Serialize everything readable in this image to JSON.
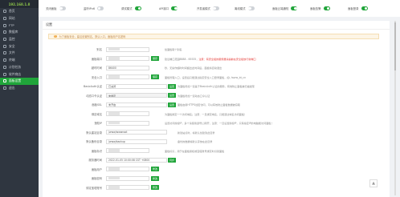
{
  "app": {
    "logo": "192.168.1.8"
  },
  "sidebar": {
    "items": [
      {
        "label": "首页",
        "icon": "home-icon",
        "color": "#9aa3ad"
      },
      {
        "label": "网站",
        "icon": "globe-icon",
        "color": "#9aa3ad"
      },
      {
        "label": "FTP",
        "icon": "ftp-icon",
        "color": "#9aa3ad"
      },
      {
        "label": "数据库",
        "icon": "database-icon",
        "color": "#9aa3ad"
      },
      {
        "label": "监控",
        "icon": "monitor-icon",
        "color": "#9aa3ad"
      },
      {
        "label": "安全",
        "icon": "shield-icon",
        "color": "#9aa3ad"
      },
      {
        "label": "文件",
        "icon": "folder-icon",
        "color": "#9aa3ad"
      },
      {
        "label": "终端",
        "icon": "terminal-icon",
        "color": "#9aa3ad"
      },
      {
        "label": "计划任务",
        "icon": "clock-icon",
        "color": "#9aa3ad"
      },
      {
        "label": "软件商店",
        "icon": "store-icon",
        "color": "#9aa3ad"
      },
      {
        "label": "面板设置",
        "icon": "gear-icon",
        "color": "#ffffff",
        "active": true
      },
      {
        "label": "退出",
        "icon": "logout-icon",
        "color": "#9aa3ad"
      }
    ]
  },
  "topbar": {
    "toggles": [
      {
        "label": "关闭面板",
        "on": false
      },
      {
        "label": "监听IPv6",
        "on": false
      },
      {
        "label": "调试模式",
        "on": true
      },
      {
        "label": "API接口",
        "on": true
      },
      {
        "label": "开发者模式",
        "on": false
      },
      {
        "label": "离线模式",
        "on": false
      },
      {
        "label": "面板云端通知",
        "on": true
      },
      {
        "label": "面板告警",
        "on": true
      },
      {
        "label": "面板登录",
        "on": true
      }
    ]
  },
  "panel": {
    "title": "设置",
    "alert": "为了面板安全，建议设置别名，默认入口，面板用户名密码",
    "rows": [
      {
        "label": "别名",
        "value": "",
        "masked": true,
        "hint": "给面板取个别名"
      },
      {
        "label": "面板端口",
        "value": "",
        "masked": true,
        "button": "保存",
        "hint": "建议端口范围8888 - 65535，注意：有安全组的服务器请提前在安全组放行新端口",
        "hint_warn": "注意：有安全组的服务器请提前在安全组放行新端口"
      },
      {
        "label": "超时时间",
        "value": "86400",
        "button": "",
        "hint": "秒，无操作超时时间超出此时间后，面板将自动退出"
      },
      {
        "label": "安全入口",
        "value": "",
        "masked": true,
        "button": "保存",
        "hint": "面板管理入口，设置后只能通过指定安全入口登录面板，如: /www_bt_cn"
      },
      {
        "label": "BasicAuth认证",
        "value": "已关闭",
        "button": "设置",
        "hint": "为面板增加一道基于BasicAuth认证的服务，有效防止面板被扫描发现"
      },
      {
        "label": "动态口令认证",
        "value": "未绑定",
        "button": "设置",
        "hint": "为面板增加一道动态口令认证",
        "gray": true
      },
      {
        "label": "面板SSL",
        "value": "未开启",
        "button": "设置",
        "hint": "面板启用HTTPS加密访问，可以有效防止面板数据被窃取"
      },
      {
        "label": "绑定域名",
        "value": "",
        "masked": true,
        "button": "",
        "hint": "为面板绑定一个访问域名；注意：一旦绑定域名，只能通过域名访问面板！"
      },
      {
        "label": "授权IP",
        "value": "",
        "masked": true,
        "button": "",
        "hint": "设置访问授权IP，多个请使用逗号(,)隔开，注意：一旦设置授权IP，只有指定IP的电脑能访问面板！"
      },
      {
        "label": "默认建站目录",
        "value": "/www/wwwroot",
        "button": "",
        "hint": "新建站点时，将默认创建到此目录"
      },
      {
        "label": "默认备份目录",
        "value": "/www/backup",
        "button": "",
        "hint": "备份的数据将默认存放在此目录"
      },
      {
        "label": "面板标识",
        "value": "",
        "masked": true,
        "button": "",
        "hint": "面板标识，用于在面板授权或宝塔账号绑定时识别面板"
      },
      {
        "label": "服务器时间",
        "value": "2022-01-05 10:00:08 CST +0800",
        "button": "同步",
        "hint": ""
      },
      {
        "label": "面板用户",
        "value": "",
        "masked": true,
        "button": "修改",
        "hint": ""
      },
      {
        "label": "面板密码",
        "value": "",
        "masked": true,
        "button": "修改",
        "hint": ""
      },
      {
        "label": "绑定宝塔账号",
        "value": "",
        "masked": true,
        "button": "修改",
        "hint": ""
      }
    ],
    "save_button": "保存"
  },
  "colors": {
    "accent": "#20a53a",
    "sidebar_bg": "#2f3640",
    "warn": "#e53935"
  }
}
